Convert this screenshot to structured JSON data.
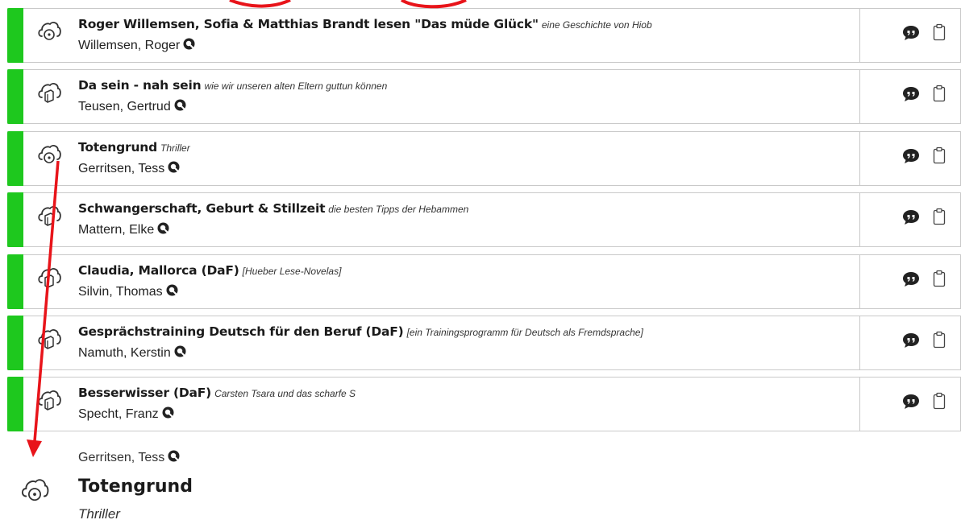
{
  "results": [
    {
      "title": "Roger Willemsen, Sofia & Matthias Brandt lesen \"Das müde Glück\"",
      "subtitle": "eine Geschichte von Hiob",
      "author": "Willemsen, Roger",
      "media_icon": "cloud-disc-icon"
    },
    {
      "title": "Da sein - nah sein",
      "subtitle": "wie wir unseren alten Eltern guttun können",
      "author": "Teusen, Gertrud",
      "media_icon": "cloud-book-icon"
    },
    {
      "title": "Totengrund",
      "subtitle": "Thriller",
      "author": "Gerritsen, Tess",
      "media_icon": "cloud-disc-icon"
    },
    {
      "title": "Schwangerschaft, Geburt & Stillzeit",
      "subtitle": "die besten Tipps der Hebammen",
      "author": "Mattern, Elke",
      "media_icon": "cloud-book-icon"
    },
    {
      "title": "Claudia, Mallorca (DaF)",
      "subtitle": "[Hueber Lese-Novelas]",
      "author": "Silvin, Thomas",
      "media_icon": "cloud-book-icon"
    },
    {
      "title": "Gesprächstraining Deutsch für den Beruf (DaF)",
      "subtitle": "[ein Trainingsprogramm für Deutsch als Fremdsprache]",
      "author": "Namuth, Kerstin",
      "media_icon": "cloud-book-icon"
    },
    {
      "title": "Besserwisser (DaF)",
      "subtitle": "Carsten Tsara und das scharfe S",
      "author": "Specht, Franz",
      "media_icon": "cloud-book-icon"
    }
  ],
  "detail": {
    "author": "Gerritsen, Tess",
    "title": "Totengrund",
    "subtitle": "Thriller",
    "media_icon": "cloud-disc-icon"
  },
  "colors": {
    "availability_bar": "#1ec81e",
    "annotation": "#e8141a",
    "border": "#c9c9c9"
  }
}
